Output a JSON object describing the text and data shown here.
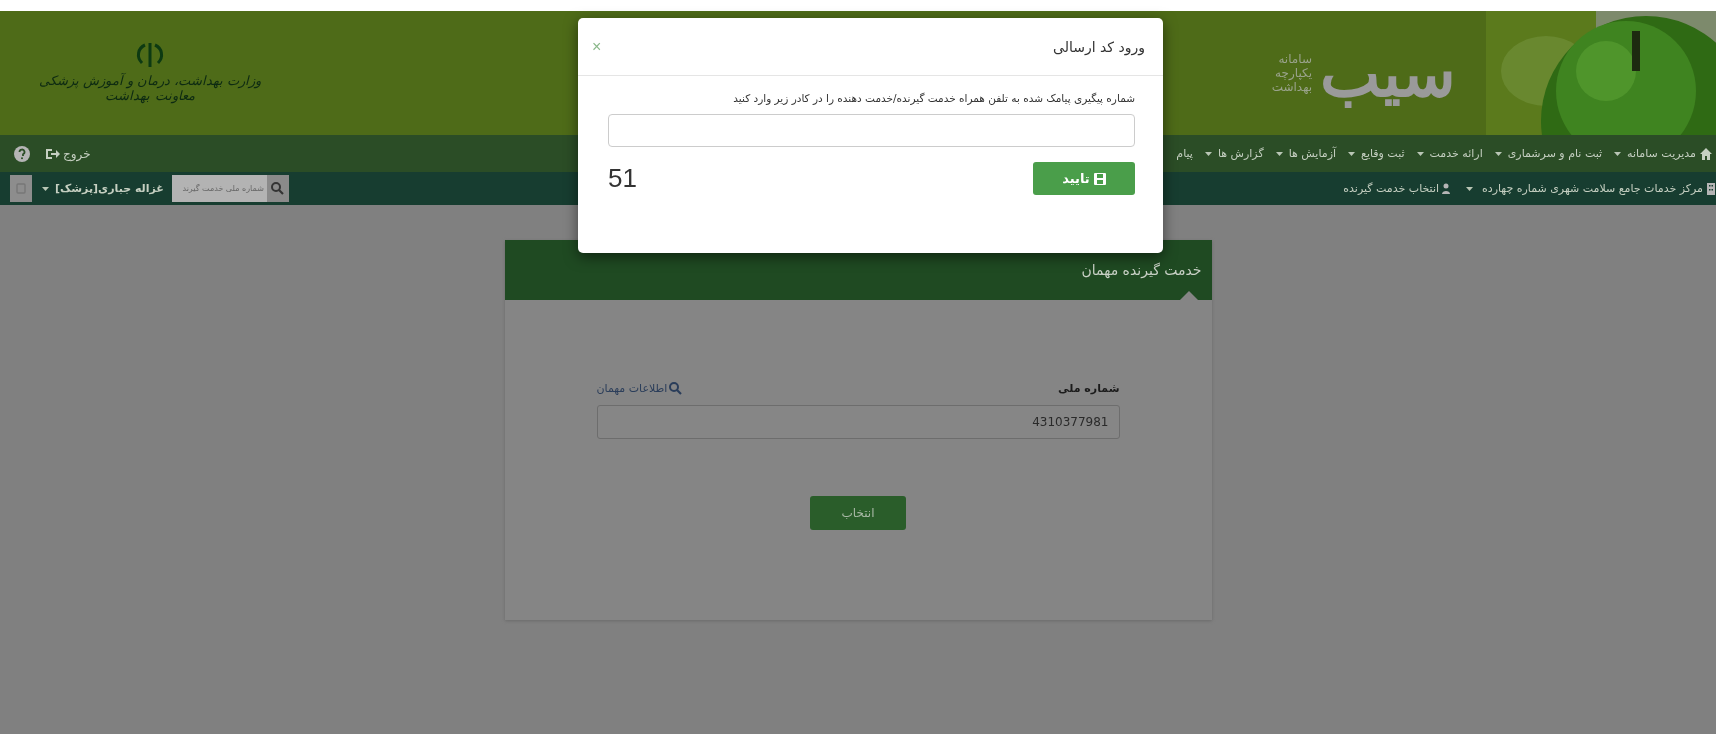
{
  "header": {
    "ministry_logo": [
      "وزارت بهداشت، درمان و آموزش پزشکی",
      "معاونت بهداشت"
    ],
    "system_tagline": [
      "سامانه",
      "یکپارچه",
      "بهداشت"
    ],
    "system_logo": "سیب"
  },
  "nav": {
    "menu": [
      {
        "label": "مدیریت سامانه",
        "has_menu": true
      },
      {
        "label": "ثبت نام و سرشماری",
        "has_menu": true
      },
      {
        "label": "ارائه خدمت",
        "has_menu": true
      },
      {
        "label": "ثبت وقایع",
        "has_menu": true
      },
      {
        "label": "آزمایش ها",
        "has_menu": true
      },
      {
        "label": "گزارش ها",
        "has_menu": true
      },
      {
        "label": "پیام",
        "has_menu": false
      }
    ],
    "exit": "خروج"
  },
  "subbar": {
    "center": "مرکز خدمات جامع سلامت شهری شماره چهارده",
    "select_client": "انتخاب خدمت گیرنده",
    "user": "غزاله جباری[پزشک]",
    "search": {
      "placeholder": "شماره ملی خدمت گیرند"
    }
  },
  "card": {
    "title": "خدمت گیرنده مهمان",
    "field_label": "شماره ملی",
    "info_link": "اطلاعات مهمان",
    "field_value": "4310377981",
    "button": "انتخاب"
  },
  "modal": {
    "title": "ورود کد ارسالی",
    "close": "×",
    "instruction": "شماره پیگیری پیامک شده به تلفن همراه خدمت گیرنده/خدمت دهنده را در کادر زیر وارد کنید",
    "counter": "51",
    "confirm": "تایید"
  }
}
